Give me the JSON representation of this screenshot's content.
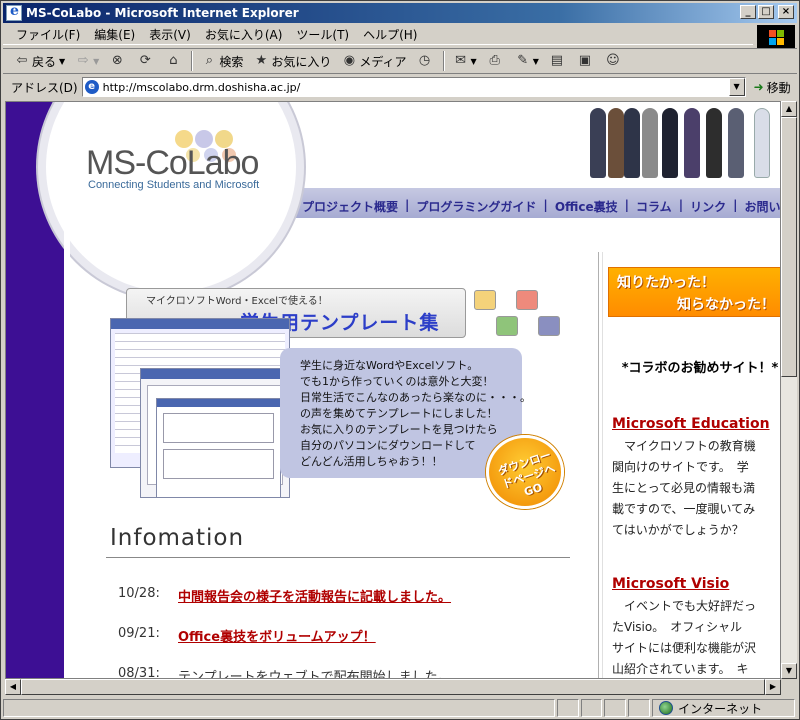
{
  "window": {
    "title": "MS-CoLabo - Microsoft Internet Explorer",
    "min": "_",
    "max": "□",
    "close": "×"
  },
  "menu": [
    "ファイル(F)",
    "編集(E)",
    "表示(V)",
    "お気に入り(A)",
    "ツール(T)",
    "ヘルプ(H)"
  ],
  "toolbar": {
    "back": "戻る",
    "search": "検索",
    "favorites": "お気に入り",
    "media": "メディア"
  },
  "address": {
    "label": "アドレス(D)",
    "url": "http://mscolabo.drm.doshisha.ac.jp/",
    "go": "移動"
  },
  "status": {
    "zone": "インターネット"
  },
  "page": {
    "logo": "MS-CoLabo",
    "logo_sub": "Connecting Students and Microsoft",
    "nav": [
      "プロジェクト概要",
      "プログラミングガイド",
      "Office裏技",
      "コラム",
      "リンク",
      "お問い合わせ"
    ],
    "template": {
      "small": "マイクロソフトWord・Excelで使える！",
      "big": "学生用テンプレート集",
      "lines": [
        "学生に身近なWordやExcelソフト。",
        "でも1から作っていくのは意外と大変！",
        "日常生活でこんなのあったら楽なのに・・・。",
        "の声を集めてテンプレートにしました！",
        "お気に入りのテンプレートを見つけたら",
        "自分のパソコンにダウンロードして",
        "どんどん活用しちゃおう！！"
      ],
      "badge": "ダウンロードページへGO"
    },
    "info_title": "Infomation",
    "news": [
      {
        "date": "10/28:",
        "text": "中間報告会の様子を活動報告に記載しました。",
        "link": true
      },
      {
        "date": "09/21:",
        "text": "Office裏技をボリュームアップ！",
        "link": true
      },
      {
        "date": "08/31:",
        "text": "テンプレートをウェブトで配布開始しました。",
        "link": false
      }
    ],
    "side": {
      "banner_line1": "知りたかった！",
      "banner_line2": "知らなかった！",
      "heading": "*コラボのお勧めサイト！*",
      "items": [
        {
          "title": "Microsoft Education",
          "lines": [
            "　マイクロソフトの教育機",
            "関向けのサイトです。　学",
            "生にとって必見の情報も満",
            "載ですので、一度覗いてみ",
            "てはいかがでしょうか？"
          ]
        },
        {
          "title": "Microsoft Visio",
          "lines": [
            "　イベントでも大好評だっ",
            "たVisio。　オフィシャル",
            "サイトには便利な機能が沢",
            "山紹介されています。　キ"
          ]
        }
      ]
    }
  },
  "colors": {
    "titlebar": "#0a246a",
    "leftbar": "#3d0f94",
    "nav_text": "#2b2a8e",
    "link": "#b00000",
    "banner": "#ff8c00"
  }
}
